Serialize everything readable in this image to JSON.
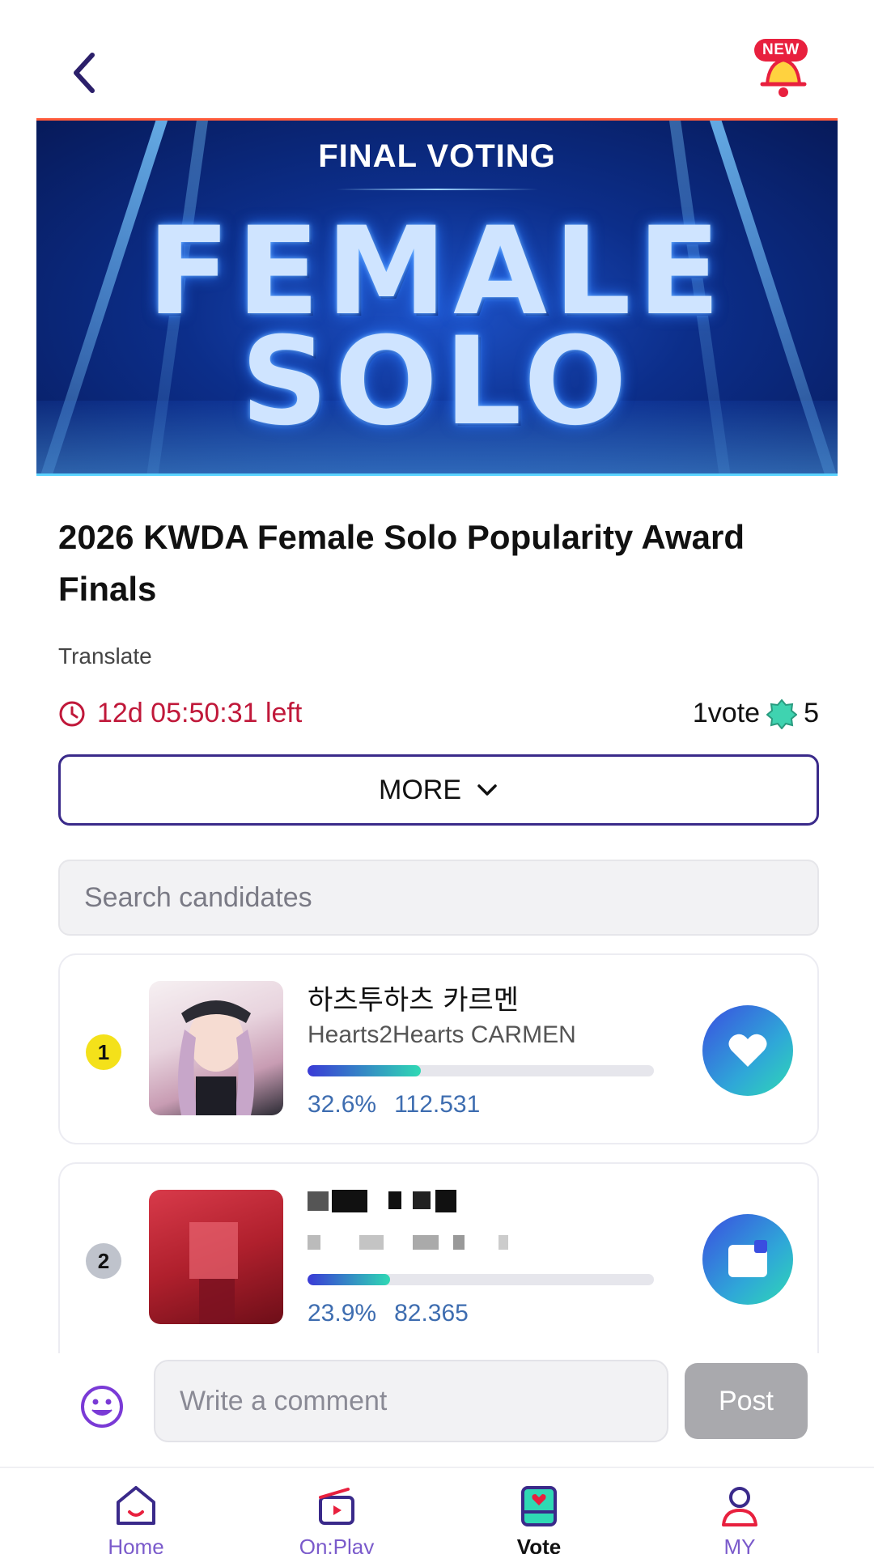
{
  "header": {
    "back_icon": "back-chevron-icon",
    "notification_icon": "bell-icon",
    "new_badge": "NEW"
  },
  "banner": {
    "subtitle": "FINAL VOTING",
    "title_line1": "FEMALE",
    "title_line2": "SOLO"
  },
  "event": {
    "title": "2026 KWDA Female Solo Popularity Award Finals",
    "translate_label": "Translate",
    "time_left": "12d 05:50:31 left",
    "vote_label": "1vote",
    "vote_cost": "5",
    "more_label": "MORE"
  },
  "search": {
    "placeholder": "Search candidates"
  },
  "candidates": [
    {
      "rank": "1",
      "name_ko": "하츠투하츠 카르멘",
      "name_en": "Hearts2Hearts CARMEN",
      "percent": "32.6%",
      "percent_value": 0.326,
      "votes": "112.531"
    },
    {
      "rank": "2",
      "name_ko": "",
      "name_en": "",
      "percent": "23.9%",
      "percent_value": 0.239,
      "votes": "82.365"
    }
  ],
  "comment": {
    "placeholder": "Write a comment",
    "post_label": "Post"
  },
  "nav": [
    {
      "label": "Home",
      "icon": "home-icon",
      "active": false
    },
    {
      "label": "On:Play",
      "icon": "clapperboard-icon",
      "active": false
    },
    {
      "label": "Vote",
      "icon": "vote-box-icon",
      "active": true
    },
    {
      "label": "MY",
      "icon": "profile-icon",
      "active": false
    }
  ],
  "colors": {
    "accent": "#7a5acb",
    "timer": "#c0183a",
    "vote_gradient_start": "#3a4ee0",
    "vote_gradient_end": "#2fd9b4"
  }
}
